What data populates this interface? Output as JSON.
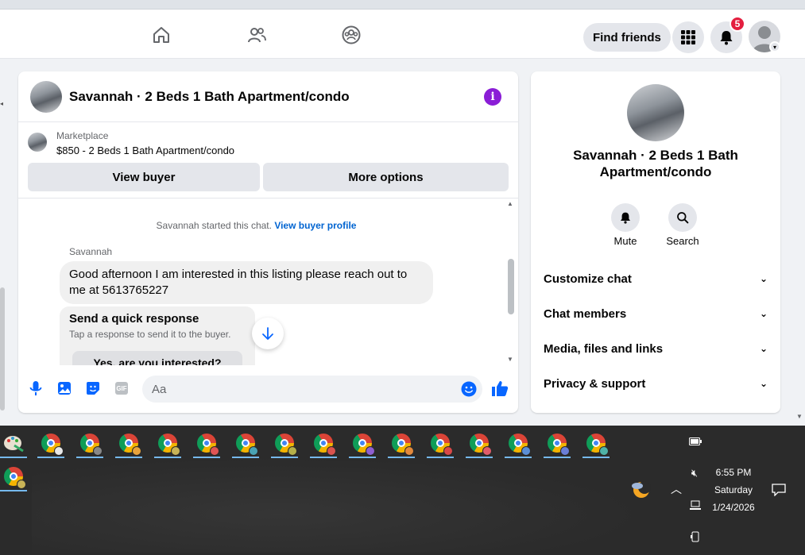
{
  "topnav": {
    "find_friends_label": "Find friends",
    "notification_count": "5"
  },
  "chat": {
    "title": "Savannah · 2 Beds 1 Bath Apartment/condo",
    "marketplace_label": "Marketplace",
    "listing_price_title": "$850 - 2 Beds 1 Bath Apartment/condo",
    "view_buyer_label": "View buyer",
    "more_options_label": "More options",
    "started_text": "Savannah started this chat.",
    "view_buyer_profile_link": "View buyer profile",
    "sender_name": "Savannah",
    "message_text": "Good afternoon I am interested in this listing please reach out to me at 5613765227",
    "quick_response_title": "Send a quick response",
    "quick_response_sub": "Tap a response to send it to the buyer.",
    "quick_response_option": "Yes, are you interested?",
    "composer_placeholder": "Aa",
    "gif_label": "GIF"
  },
  "info_panel": {
    "title": "Savannah · 2 Beds 1 Bath Apartment/condo",
    "mute_label": "Mute",
    "search_label": "Search",
    "rows": [
      "Customize chat",
      "Chat members",
      "Media, files and links",
      "Privacy & support"
    ]
  },
  "taskbar": {
    "time": "6:55 PM",
    "day": "Saturday",
    "date": "1/24/2026"
  },
  "colors": {
    "accent_blue": "#0064d1",
    "messenger_purple": "#8a1dd6",
    "like_blue": "#0866ff",
    "badge_red": "#e41e3f",
    "taskbar_bg": "#2b2b2b"
  }
}
